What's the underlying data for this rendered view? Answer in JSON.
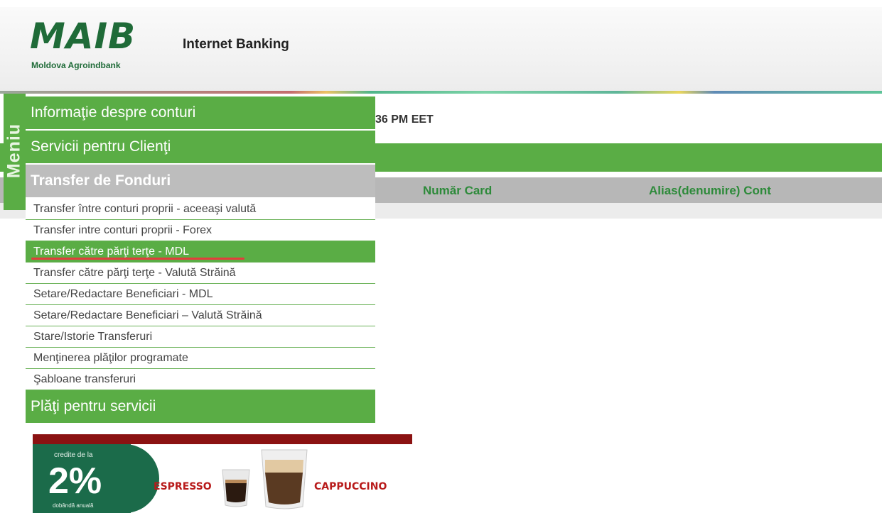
{
  "header": {
    "logo_text": "MAIB",
    "logo_subtitle": "Moldova Agroindbank",
    "title": "Internet Banking"
  },
  "main": {
    "time_fragment": "36 PM EET",
    "table_columns": [
      "Număr Card",
      "Alias(denumire) Cont"
    ]
  },
  "menu": {
    "tab_label": "Meniu",
    "sections": [
      {
        "label": "Informaţie despre conturi"
      },
      {
        "label": "Servicii pentru Clienţi"
      },
      {
        "label": "Transfer de Fonduri"
      },
      {
        "label": "Plăţi pentru servicii"
      }
    ],
    "transfer_items": [
      {
        "label": "Transfer între conturi proprii - aceeaşi valută"
      },
      {
        "label": "Transfer intre conturi proprii - Forex"
      },
      {
        "label": "Transfer către părţi terţe - MDL",
        "active": true
      },
      {
        "label": "Transfer către părţi terţe - Valută Străină"
      },
      {
        "label": "Setare/Redactare Beneficiari - MDL"
      },
      {
        "label": "Setare/Redactare Beneficiari – Valută Străină"
      },
      {
        "label": "Stare/Istorie Transferuri"
      },
      {
        "label": "Menţinerea plăţilor programate"
      },
      {
        "label": "Şabloane transferuri"
      }
    ]
  },
  "ad": {
    "credit_label": "credite de la",
    "rate": "2%",
    "rate_note": "dobândă anuală",
    "product_1": "ESPRESSO",
    "product_2": "CAPPUCCINO"
  },
  "colors": {
    "brand_green": "#5aad45",
    "logo_green": "#1f6b38",
    "highlight_underline": "#e33c3c",
    "ad_red": "#b81b1b"
  }
}
